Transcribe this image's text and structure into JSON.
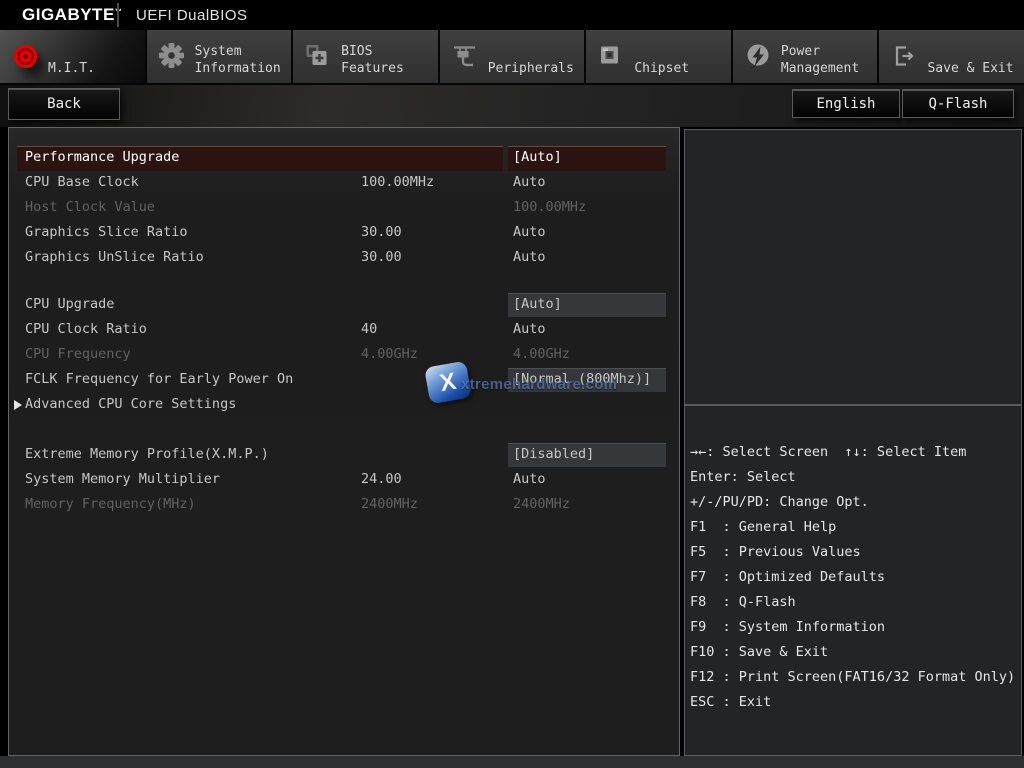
{
  "topbar": {
    "brand": "GIGABYTE",
    "trademark": "™",
    "title": "UEFI DualBIOS"
  },
  "tabbar": {
    "tabs": [
      {
        "id": "mit",
        "line1": "M.I.T.",
        "line2": "",
        "icon": "mit-red-ball-icon",
        "active": true
      },
      {
        "id": "system-information",
        "line1": "System",
        "line2": "Information",
        "icon": "gear-icon",
        "active": false
      },
      {
        "id": "bios-features",
        "line1": "BIOS",
        "line2": "Features",
        "icon": "bios-chip-plus-icon",
        "active": false
      },
      {
        "id": "peripherals",
        "line1": "Peripherals",
        "line2": "",
        "icon": "peripherals-icon",
        "active": false
      },
      {
        "id": "chipset",
        "line1": "Chipset",
        "line2": "",
        "icon": "chipset-icon",
        "active": false
      },
      {
        "id": "power-management",
        "line1": "Power",
        "line2": "Management",
        "icon": "power-bolt-icon",
        "active": false
      },
      {
        "id": "save-exit",
        "line1": "Save & Exit",
        "line2": "",
        "icon": "exit-arrow-icon",
        "active": false
      }
    ]
  },
  "toolbar": {
    "back_label": "Back",
    "english_label": "English",
    "qflash_label": "Q-Flash"
  },
  "settings": {
    "rows": [
      {
        "name": "Performance Upgrade",
        "value2": "",
        "value3": "[Auto]",
        "state": "selected"
      },
      {
        "name": "CPU Base Clock",
        "value2": "100.00MHz",
        "value3": "Auto",
        "state": "normal"
      },
      {
        "name": "Host Clock Value",
        "value2": "",
        "value3": "100.00MHz",
        "state": "disabled"
      },
      {
        "name": "Graphics Slice Ratio",
        "value2": "30.00",
        "value3": "Auto",
        "state": "normal"
      },
      {
        "name": "Graphics UnSlice Ratio",
        "value2": "30.00",
        "value3": "Auto",
        "state": "normal"
      },
      {
        "name": "CPU Upgrade",
        "value2": "",
        "value3": "[Auto]",
        "state": "boxed"
      },
      {
        "name": "CPU Clock Ratio",
        "value2": "40",
        "value3": "Auto",
        "state": "normal"
      },
      {
        "name": "CPU Frequency",
        "value2": "4.00GHz",
        "value3": "4.00GHz",
        "state": "disabled"
      },
      {
        "name": "FCLK Frequency for Early Power On",
        "value2": "",
        "value3": "[Normal (800Mhz)]",
        "state": "boxed"
      },
      {
        "name": "Advanced CPU Core Settings",
        "value2": "",
        "value3": "",
        "state": "submenu"
      },
      {
        "name": "Extreme Memory Profile(X.M.P.)",
        "value2": "",
        "value3": "[Disabled]",
        "state": "boxed"
      },
      {
        "name": "System Memory Multiplier",
        "value2": "24.00",
        "value3": "Auto",
        "state": "normal"
      },
      {
        "name": "Memory Frequency(MHz)",
        "value2": "2400MHz",
        "value3": "2400MHz",
        "state": "disabled"
      }
    ]
  },
  "help": {
    "lines": [
      "→←: Select Screen  ↑↓: Select Item",
      "Enter: Select",
      "+/-/PU/PD: Change Opt.",
      "F1  : General Help",
      "F5  : Previous Values",
      "F7  : Optimized Defaults",
      "F8  : Q-Flash",
      "F9  : System Information",
      "F10 : Save & Exit",
      "F12 : Print Screen(FAT16/32 Format Only)",
      "ESC : Exit"
    ]
  },
  "watermark": {
    "text": "xtremehardware.com",
    "logo_letter": "X"
  },
  "colors": {
    "accent_red": "#e60000",
    "selected_row_bg": "#2b130f",
    "value_box_bg": "#35373a",
    "tab_bg": "#3a3a3a",
    "help_text": "#e6e6e6"
  }
}
